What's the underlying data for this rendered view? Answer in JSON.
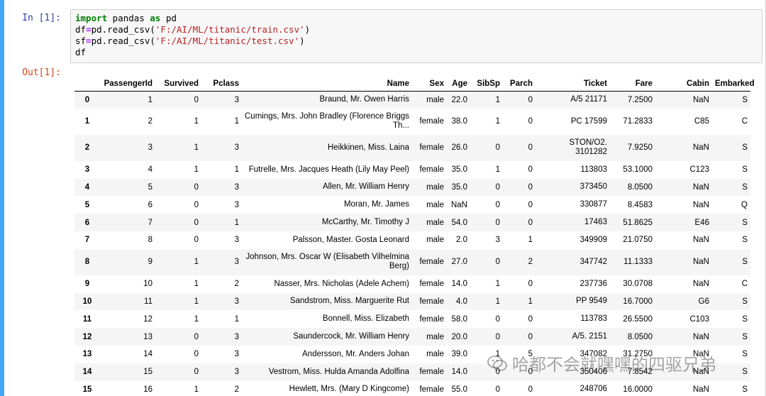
{
  "prompts": {
    "in": "In  [1]:",
    "out": "Out[1]:"
  },
  "code": {
    "line1": {
      "kw": "import",
      "a": " pandas ",
      "kw2": "as",
      "b": " pd"
    },
    "line2": {
      "a": "df",
      "op": "=",
      "b": "pd.read_csv(",
      "s": "'F:/AI/ML/titanic/train.csv'",
      "c": ")"
    },
    "line3": {
      "a": "sf",
      "op": "=",
      "b": "pd.read_csv(",
      "s": "'F:/AI/ML/titanic/test.csv'",
      "c": ")"
    },
    "line4": "df"
  },
  "table": {
    "columns": [
      "",
      "PassengerId",
      "Survived",
      "Pclass",
      "Name",
      "Sex",
      "Age",
      "SibSp",
      "Parch",
      "Ticket",
      "Fare",
      "Cabin",
      "Embarked"
    ],
    "rows": [
      [
        "0",
        "1",
        "0",
        "3",
        "Braund, Mr. Owen Harris",
        "male",
        "22.0",
        "1",
        "0",
        "A/5 21171",
        "7.2500",
        "NaN",
        "S"
      ],
      [
        "1",
        "2",
        "1",
        "1",
        "Cumings, Mrs. John Bradley (Florence Briggs Th...",
        "female",
        "38.0",
        "1",
        "0",
        "PC 17599",
        "71.2833",
        "C85",
        "C"
      ],
      [
        "2",
        "3",
        "1",
        "3",
        "Heikkinen, Miss. Laina",
        "female",
        "26.0",
        "0",
        "0",
        "STON/O2. 3101282",
        "7.9250",
        "NaN",
        "S"
      ],
      [
        "3",
        "4",
        "1",
        "1",
        "Futrelle, Mrs. Jacques Heath (Lily May Peel)",
        "female",
        "35.0",
        "1",
        "0",
        "113803",
        "53.1000",
        "C123",
        "S"
      ],
      [
        "4",
        "5",
        "0",
        "3",
        "Allen, Mr. William Henry",
        "male",
        "35.0",
        "0",
        "0",
        "373450",
        "8.0500",
        "NaN",
        "S"
      ],
      [
        "5",
        "6",
        "0",
        "3",
        "Moran, Mr. James",
        "male",
        "NaN",
        "0",
        "0",
        "330877",
        "8.4583",
        "NaN",
        "Q"
      ],
      [
        "6",
        "7",
        "0",
        "1",
        "McCarthy, Mr. Timothy J",
        "male",
        "54.0",
        "0",
        "0",
        "17463",
        "51.8625",
        "E46",
        "S"
      ],
      [
        "7",
        "8",
        "0",
        "3",
        "Palsson, Master. Gosta Leonard",
        "male",
        "2.0",
        "3",
        "1",
        "349909",
        "21.0750",
        "NaN",
        "S"
      ],
      [
        "8",
        "9",
        "1",
        "3",
        "Johnson, Mrs. Oscar W (Elisabeth Vilhelmina Berg)",
        "female",
        "27.0",
        "0",
        "2",
        "347742",
        "11.1333",
        "NaN",
        "S"
      ],
      [
        "9",
        "10",
        "1",
        "2",
        "Nasser, Mrs. Nicholas (Adele Achem)",
        "female",
        "14.0",
        "1",
        "0",
        "237736",
        "30.0708",
        "NaN",
        "C"
      ],
      [
        "10",
        "11",
        "1",
        "3",
        "Sandstrom, Miss. Marguerite Rut",
        "female",
        "4.0",
        "1",
        "1",
        "PP 9549",
        "16.7000",
        "G6",
        "S"
      ],
      [
        "11",
        "12",
        "1",
        "1",
        "Bonnell, Miss. Elizabeth",
        "female",
        "58.0",
        "0",
        "0",
        "113783",
        "26.5500",
        "C103",
        "S"
      ],
      [
        "12",
        "13",
        "0",
        "3",
        "Saundercock, Mr. William Henry",
        "male",
        "20.0",
        "0",
        "0",
        "A/5. 2151",
        "8.0500",
        "NaN",
        "S"
      ],
      [
        "13",
        "14",
        "0",
        "3",
        "Andersson, Mr. Anders Johan",
        "male",
        "39.0",
        "1",
        "5",
        "347082",
        "31.2750",
        "NaN",
        "S"
      ],
      [
        "14",
        "15",
        "0",
        "3",
        "Vestrom, Miss. Hulda Amanda Adolfina",
        "female",
        "14.0",
        "0",
        "0",
        "350406",
        "7.8542",
        "NaN",
        "S"
      ],
      [
        "15",
        "16",
        "1",
        "2",
        "Hewlett, Mrs. (Mary D Kingcome)",
        "female",
        "55.0",
        "0",
        "0",
        "248706",
        "16.0000",
        "NaN",
        "S"
      ]
    ]
  },
  "watermark": "哈都不会就嘿嘿的四驱兄弟",
  "colors": {
    "cell_border": "#42a5f5",
    "in_prompt": "#303f9f",
    "out_prompt": "#d84315",
    "keyword": "#008000",
    "string": "#ba2121",
    "operator": "#aa22ff"
  },
  "icons": {
    "watermark_logo": "wechat-icon"
  }
}
